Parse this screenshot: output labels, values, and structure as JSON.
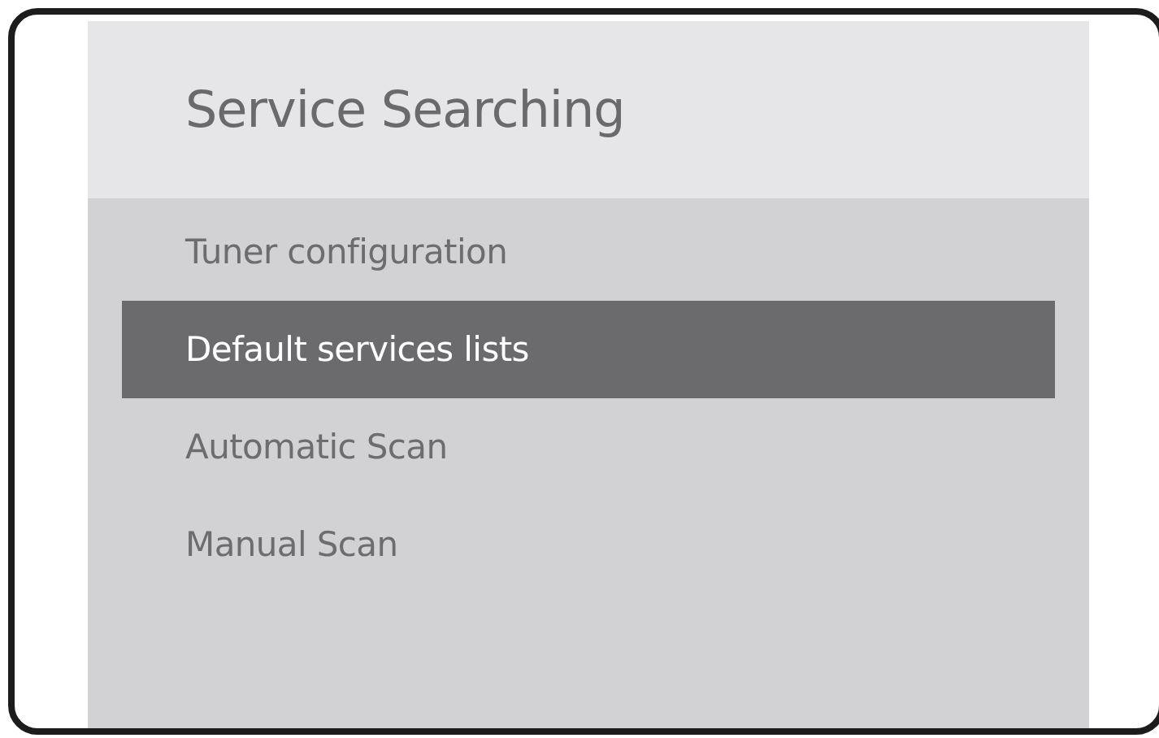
{
  "menu": {
    "title": "Service Searching",
    "items": [
      {
        "label": "Tuner configuration",
        "selected": false
      },
      {
        "label": "Default services lists",
        "selected": true
      },
      {
        "label": "Automatic Scan",
        "selected": false
      },
      {
        "label": "Manual Scan",
        "selected": false
      }
    ]
  }
}
